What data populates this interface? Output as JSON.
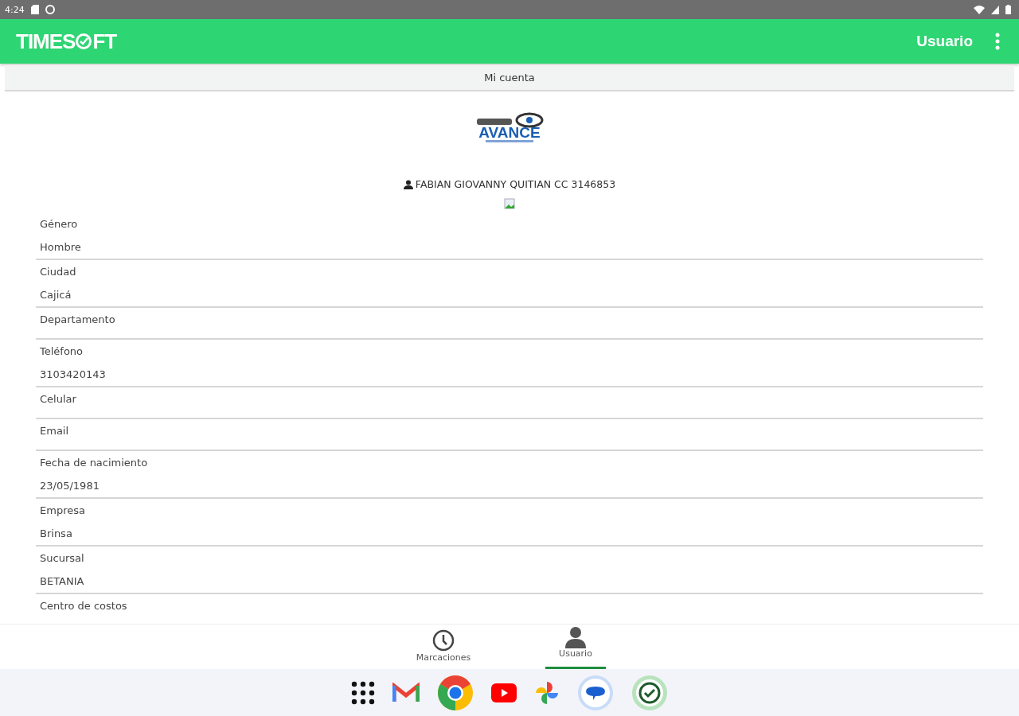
{
  "status_bar": {
    "time": "4:24"
  },
  "app_bar": {
    "logo": [
      "TIMES",
      "FT"
    ],
    "title": "Usuario"
  },
  "section_title": "Mi cuenta",
  "company_logo": {
    "name": "AVANCE"
  },
  "user": {
    "name": "FABIAN GIOVANNY QUITIAN CC 3146853"
  },
  "fields": [
    {
      "label": "Género",
      "value": "Hombre"
    },
    {
      "label": "Ciudad",
      "value": "Cajicá"
    },
    {
      "label": "Departamento"
    },
    {
      "label": "Teléfono",
      "value": "3103420143"
    },
    {
      "label": "Celular"
    },
    {
      "label": "Email"
    },
    {
      "label": "Fecha de nacimiento",
      "value": "23/05/1981"
    },
    {
      "label": "Empresa",
      "value": "Brinsa"
    },
    {
      "label": "Sucursal",
      "value": "BETANIA"
    },
    {
      "label": "Centro de costos"
    }
  ],
  "bottom_nav": [
    {
      "label": "Marcaciones",
      "kind": "clock",
      "selected": false
    },
    {
      "label": "Usuario",
      "kind": "person",
      "selected": true
    }
  ],
  "dock": [
    {
      "kind": "apps"
    },
    {
      "kind": "mail"
    },
    {
      "kind": "browser"
    },
    {
      "kind": "video"
    },
    {
      "kind": "photos"
    },
    {
      "kind": "messages"
    },
    {
      "kind": "check"
    }
  ]
}
